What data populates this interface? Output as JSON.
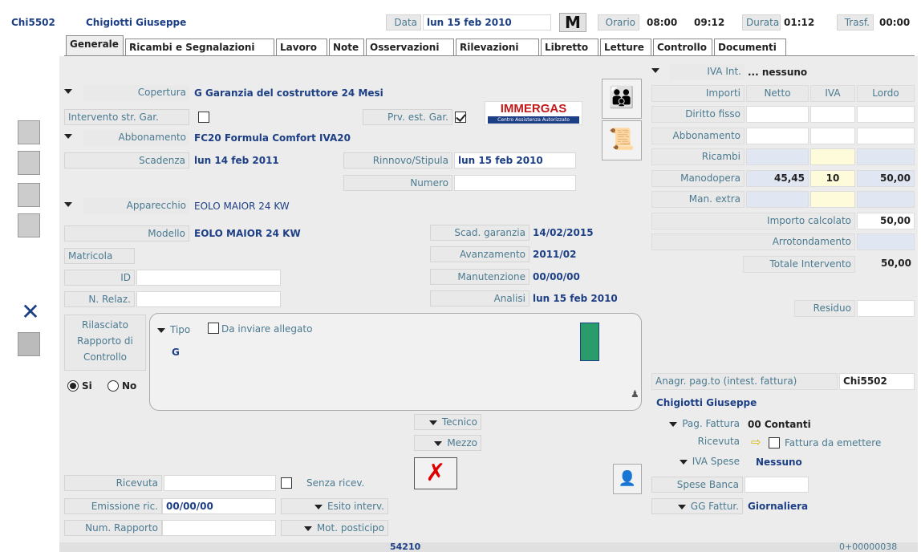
{
  "header": {
    "code": "Chi5502",
    "name": "Chigiotti Giuseppe",
    "data_label": "Data",
    "data_value": "lun 15 feb 2010",
    "m_label": "M",
    "orario_label": "Orario",
    "orario_start": "08:00",
    "orario_end": "09:12",
    "durata_label": "Durata",
    "durata_value": "01:12",
    "trasf_label": "Trasf.",
    "trasf_value": "00:00"
  },
  "tabs": [
    "Generale",
    "Ricambi e Segnalazioni",
    "Lavoro",
    "Note",
    "Osservazioni",
    "Rilevazioni",
    "Libretto",
    "Letture",
    "Controllo",
    "Documenti"
  ],
  "left": {
    "copertura_label": "Copertura",
    "copertura_value": "G Garanzia del costruttore 24 Mesi",
    "intervento_label": "Intervento str. Gar.",
    "prv_label": "Prv. est. Gar.",
    "abbonamento_label": "Abbonamento",
    "abbonamento_value": "FC20 Formula Comfort IVA20",
    "scadenza_label": "Scadenza",
    "scadenza_value": "lun 14 feb 2011",
    "rinnovo_label": "Rinnovo/Stipula",
    "rinnovo_value": "lun 15 feb 2010",
    "numero_label": "Numero",
    "apparecchio_label": "Apparecchio",
    "apparecchio_value": "EOLO MAIOR 24 KW",
    "modello_label": "Modello",
    "modello_value": "EOLO MAIOR 24 KW",
    "matricola_label": "Matricola",
    "id_label": "ID",
    "nrelaz_label": "N. Relaz.",
    "scadgar_label": "Scad. garanzia",
    "scadgar_value": "14/02/2015",
    "avanz_label": "Avanzamento",
    "avanz_value": "2011/02",
    "manut_label": "Manutenzione",
    "manut_value": "00/00/00",
    "analisi_label": "Analisi",
    "analisi_value": "lun 15 feb 2010",
    "rilasciato_label": "Rilasciato Rapporto di Controllo",
    "si_label": "Si",
    "no_label": "No",
    "tipo_label": "Tipo",
    "da_inviare_label": "Da inviare allegato",
    "tipo_value": "G",
    "tecnico_label": "Tecnico",
    "mezzo_label": "Mezzo",
    "ricevuta_label": "Ricevuta",
    "senza_label": "Senza ricev.",
    "emissione_label": "Emissione ric.",
    "emissione_value": "00/00/00",
    "esito_label": "Esito interv.",
    "numrapp_label": "Num. Rapporto",
    "motpost_label": "Mot. posticipo",
    "logo_text": "IMMERGAS",
    "logo_sub": "Centro Assistenza Autorizzato"
  },
  "right": {
    "iva_int_label": "IVA Int.",
    "iva_int_value": "... nessuno",
    "importi_label": "Importi",
    "netto_label": "Netto",
    "iva_label": "IVA",
    "lordo_label": "Lordo",
    "rows": [
      {
        "label": "Diritto fisso",
        "netto": "",
        "iva": "",
        "lordo": "",
        "style": "w"
      },
      {
        "label": "Abbonamento",
        "netto": "",
        "iva": "",
        "lordo": "",
        "style": "w"
      },
      {
        "label": "Ricambi",
        "netto": "",
        "iva": "",
        "lordo": "",
        "style": "b"
      },
      {
        "label": "Manodopera",
        "netto": "45,45",
        "iva": "10",
        "lordo": "50,00",
        "style": "b"
      },
      {
        "label": "Man. extra",
        "netto": "",
        "iva": "",
        "lordo": "",
        "style": "b"
      }
    ],
    "importo_calc_label": "Importo calcolato",
    "importo_calc_value": "50,00",
    "arrot_label": "Arrotondamento",
    "totale_label": "Totale Intervento",
    "totale_value": "50,00",
    "residuo_label": "Residuo",
    "anagr_label": "Anagr. pag.to (intest. fattura)",
    "anagr_value": "Chi5502",
    "anagr_name": "Chigiotti Giuseppe",
    "pagfatt_label": "Pag. Fattura",
    "pagfatt_value": "00  Contanti",
    "ricevuta_label": "Ricevuta",
    "fattura_label": "Fattura da emettere",
    "ivaspese_label": "IVA Spese",
    "ivaspese_value": "Nessuno",
    "spesebanca_label": "Spese Banca",
    "ggfatt_label": "GG Fattur.",
    "ggfatt_value": "Giornaliera"
  },
  "footer": {
    "center": "54210",
    "right": "0+00000038"
  }
}
